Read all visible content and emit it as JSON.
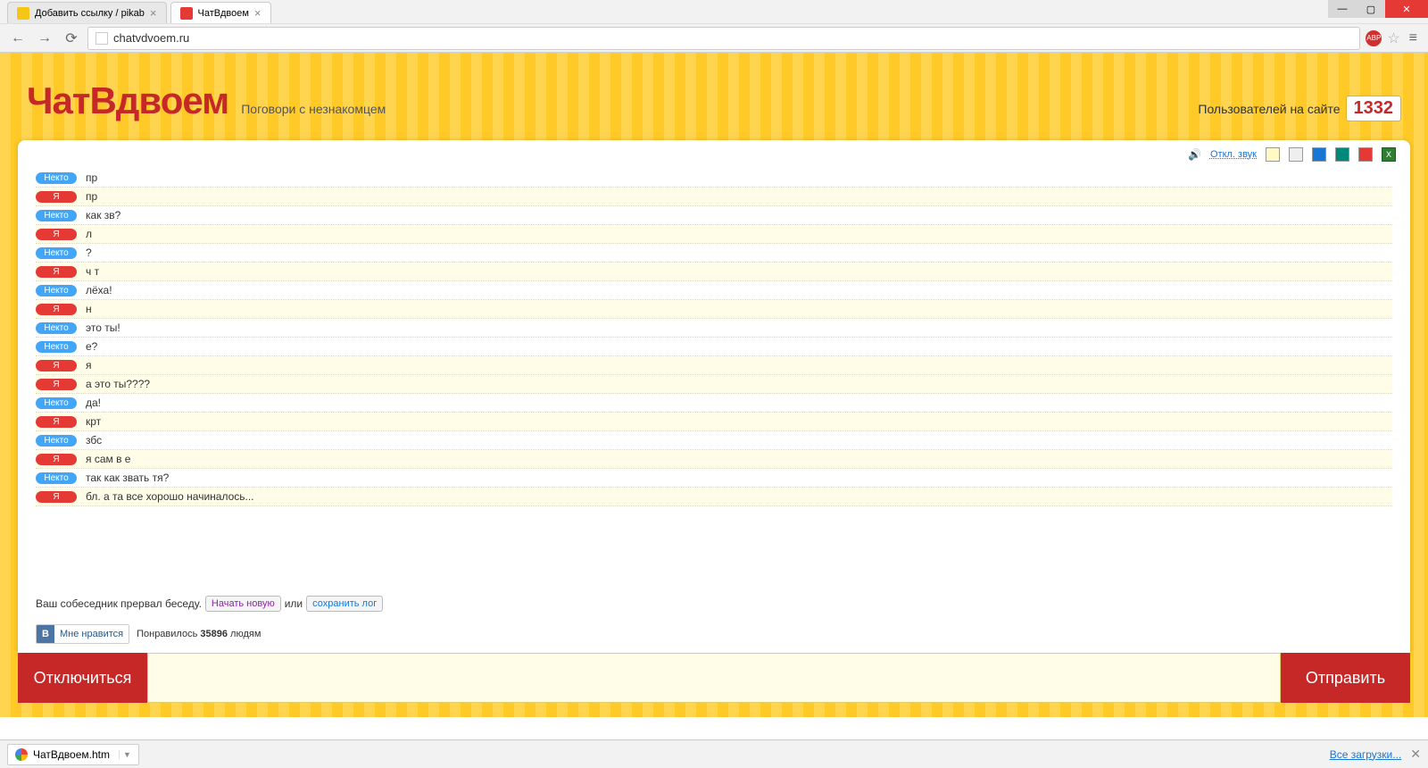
{
  "browser": {
    "tabs": [
      {
        "title": "Добавить ссылку / pikab",
        "active": false
      },
      {
        "title": "ЧатВдвоем",
        "active": true
      }
    ],
    "url": "chatvdvoem.ru"
  },
  "header": {
    "logo": "ЧатВдвоем",
    "tagline": "Поговори с незнакомцем",
    "users_label": "Пользователей на сайте",
    "users_count": "1332"
  },
  "toolbar": {
    "sound_toggle": "Откл. звук"
  },
  "labels": {
    "nekto": "Некто",
    "ya": "Я"
  },
  "messages": [
    {
      "who": "nekto",
      "text": "пр"
    },
    {
      "who": "ya",
      "text": "пр"
    },
    {
      "who": "nekto",
      "text": "как зв?"
    },
    {
      "who": "ya",
      "text": "л"
    },
    {
      "who": "nekto",
      "text": "?"
    },
    {
      "who": "ya",
      "text": "ч т"
    },
    {
      "who": "nekto",
      "text": "лёха!"
    },
    {
      "who": "ya",
      "text": "н"
    },
    {
      "who": "nekto",
      "text": "это ты!"
    },
    {
      "who": "nekto",
      "text": "е?"
    },
    {
      "who": "ya",
      "text": "я"
    },
    {
      "who": "ya",
      "text": "а это ты????"
    },
    {
      "who": "nekto",
      "text": "да!"
    },
    {
      "who": "ya",
      "text": "крт"
    },
    {
      "who": "nekto",
      "text": "збс"
    },
    {
      "who": "ya",
      "text": "я сам в е"
    },
    {
      "who": "nekto",
      "text": "так как звать тя?"
    },
    {
      "who": "ya",
      "text": "бл. а та все хорошо начиналось..."
    }
  ],
  "end": {
    "notice": "Ваш собеседник прервал беседу.",
    "start_new": "Начать новую",
    "or": "или",
    "save_log": "сохранить лог"
  },
  "likes": {
    "button": "Мне нравится",
    "prefix": "Понравилось",
    "count": "35896",
    "suffix": "людям"
  },
  "input_bar": {
    "disconnect": "Отключиться",
    "send": "Отправить"
  },
  "download_bar": {
    "file": "ЧатВдвоем.htm",
    "all": "Все загрузки..."
  }
}
